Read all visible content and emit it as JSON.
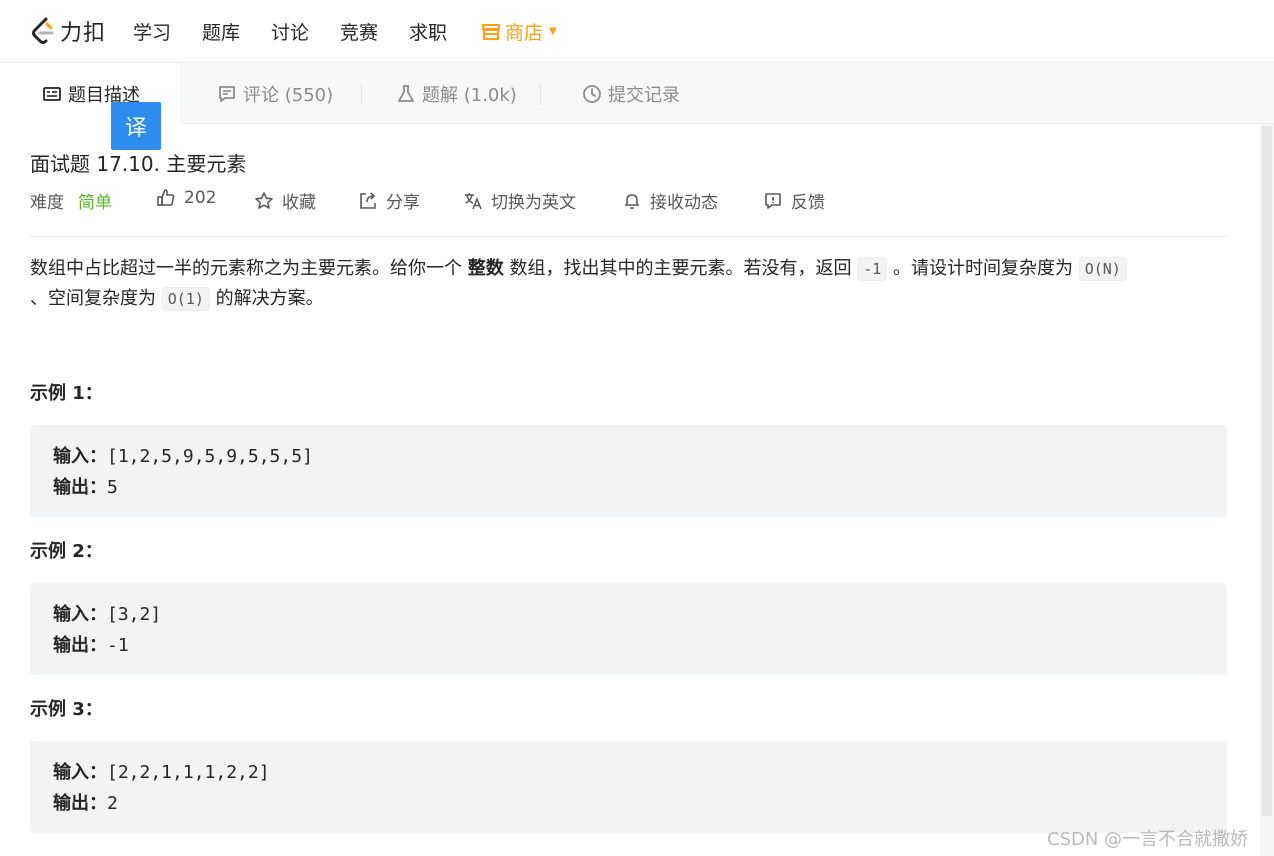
{
  "nav": {
    "logo_text": "力扣",
    "items": [
      "学习",
      "题库",
      "讨论",
      "竞赛",
      "求职"
    ],
    "store": "商店"
  },
  "tabs": [
    {
      "label": "题目描述",
      "active": true
    },
    {
      "label": "评论 (550)",
      "active": false
    },
    {
      "label": "题解 (1.0k)",
      "active": false
    },
    {
      "label": "提交记录",
      "active": false
    }
  ],
  "translate_badge": "译",
  "problem": {
    "title": "面试题 17.10. 主要元素",
    "difficulty_label": "难度",
    "difficulty": "简单",
    "likes": "202",
    "actions": [
      "收藏",
      "分享",
      "切换为英文",
      "接收动态",
      "反馈"
    ]
  },
  "description": {
    "part1": "数组中占比超过一半的元素称之为主要元素。给你一个 ",
    "bold": "整数",
    "part2": " 数组，找出其中的主要元素。若没有，返回 ",
    "code1": "-1",
    "part3": " 。请设计时间复杂度为 ",
    "code2": "O(N)",
    "part4": " 、空间复杂度为 ",
    "code3": "O(1)",
    "part5": " 的解决方案。"
  },
  "examples": [
    {
      "title": "示例 1：",
      "input_label": "输入：",
      "input": "[1,2,5,9,5,9,5,5,5]",
      "output_label": "输出：",
      "output": "5"
    },
    {
      "title": "示例 2：",
      "input_label": "输入：",
      "input": "[3,2]",
      "output_label": "输出：",
      "output": "-1"
    },
    {
      "title": "示例 3：",
      "input_label": "输入：",
      "input": "[2,2,1,1,1,2,2]",
      "output_label": "输出：",
      "output": "2"
    }
  ],
  "watermark": "CSDN @一言不合就撒娇",
  "colors": {
    "accent": "#ffa116",
    "easy": "#5ab726",
    "badge": "#2d8cf0"
  }
}
